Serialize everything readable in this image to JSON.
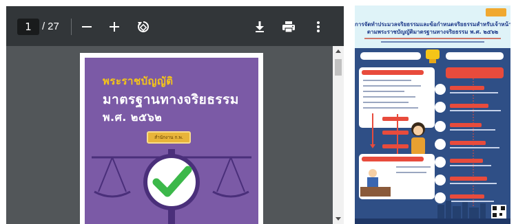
{
  "viewer": {
    "current_page": "1",
    "page_separator": "/",
    "total_pages": "27",
    "icons": {
      "zoom_out": "minus-icon",
      "zoom_in": "plus-icon",
      "rotate": "rotate-icon",
      "download": "download-icon",
      "print": "print-icon",
      "more": "more-vert-icon"
    }
  },
  "cover": {
    "title_line1": "พระราชบัญญัติ",
    "title_line2": "มาตรฐานทางจริยธรรม",
    "title_line3": "พ.ศ. ๒๕๖๒",
    "badge": "สำนักงาน ก.พ."
  },
  "infographic": {
    "title_line1": "การจัดทำประมวลจริยธรรมและข้อกำหนดจริยธรรมสำหรับเจ้าหน้าที่ของรัฐ",
    "title_line2": "ตามพระราชบัญญัติมาตรฐานทางจริยธรรม พ.ศ. ๒๕๖๒"
  },
  "colors": {
    "toolbar": "#323639",
    "viewer_bg": "#525659",
    "cover_purple": "#7b5aa6",
    "cover_gold": "#f5c518",
    "check_green": "#3cb84a",
    "info_navy": "#2f4f86",
    "info_title": "#1e3a8a",
    "info_red": "#c8402e"
  }
}
